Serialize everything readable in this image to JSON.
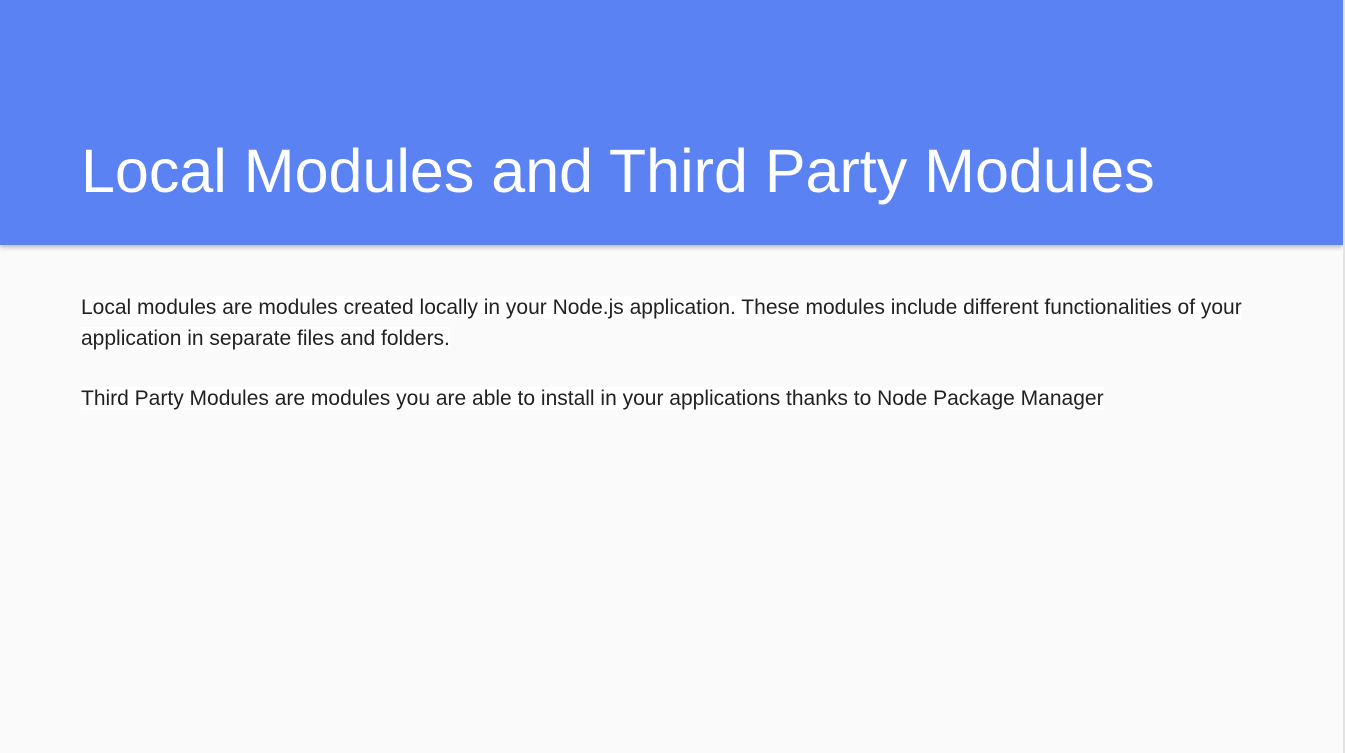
{
  "slide": {
    "title": "Local Modules and Third Party Modules",
    "paragraphs": [
      "Local modules are modules created locally in your Node.js application. These modules include different functionalities of your application in separate files and folders.",
      "Third Party Modules are modules you are able to install in your applications thanks to Node Package Manager"
    ]
  },
  "colors": {
    "header_background": "#5a82f3",
    "title_text": "#ffffff",
    "body_background": "#fafafa",
    "body_text": "#212121"
  }
}
